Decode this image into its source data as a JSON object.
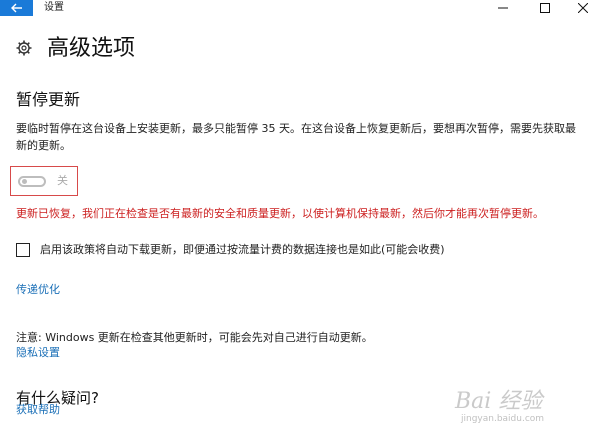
{
  "window": {
    "title": "设置",
    "controls": [
      "minimize-icon",
      "maximize-icon",
      "close-icon"
    ]
  },
  "page": {
    "title": "高级选项",
    "icon": "gear-icon"
  },
  "pause": {
    "heading": "暂停更新",
    "description": "要临时暂停在这台设备上安装更新，最多只能暂停 35 天。在这台设备上恢复更新后，要想再次暂停，需要先获取最新的更新。",
    "toggle_state": "关",
    "toggle_on": false,
    "warning": "更新已恢复，我们正在检查是否有最新的安全和质量更新，以使计算机保持最新，然后你才能再次暂停更新。"
  },
  "metered": {
    "checked": false,
    "label": "启用该政策将自动下载更新，即便通过按流量计费的数据连接也是如此(可能会收费)"
  },
  "links": {
    "delivery_optimization": "传递优化",
    "privacy_settings": "隐私设置",
    "get_help": "获取帮助"
  },
  "note": "注意: Windows 更新在检查其他更新时，可能会先对自己进行自动更新。",
  "help": {
    "heading": "有什么疑问?"
  },
  "watermark": {
    "text": "Bai 经验",
    "url": "jingyan.baidu.com"
  },
  "colors": {
    "accent": "#1a7ad8",
    "link": "#1a6fb7",
    "warning": "#cc1f1f"
  }
}
